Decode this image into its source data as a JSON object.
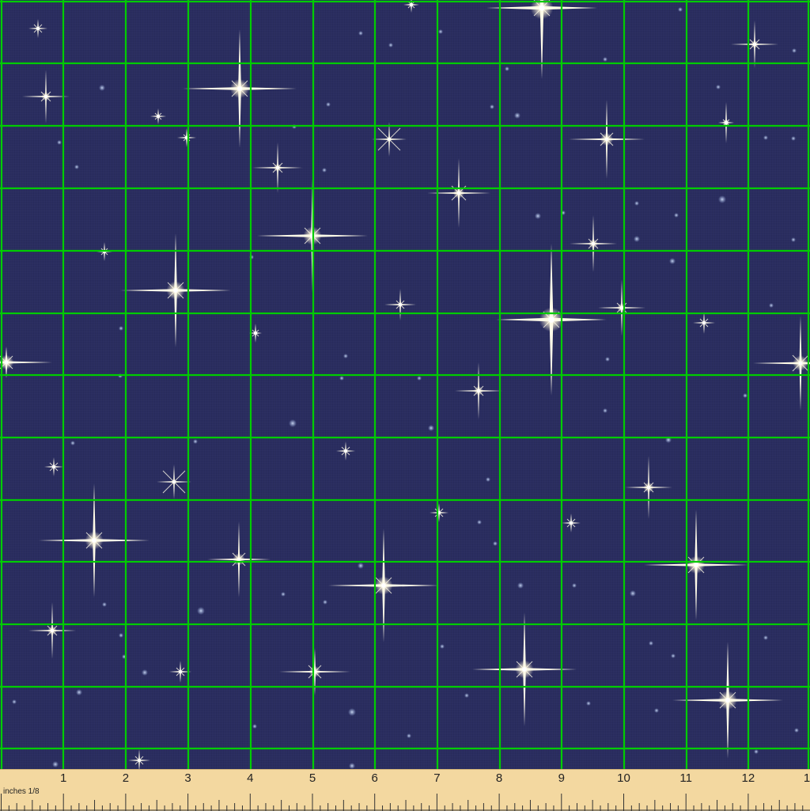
{
  "ruler": {
    "unit_label": "inches 1/8",
    "numbers": [
      "1",
      "2",
      "3",
      "4",
      "5",
      "6",
      "7",
      "8",
      "9",
      "10",
      "11",
      "12",
      "1"
    ]
  },
  "colors": {
    "background": "#2a2d60",
    "grid": "#00cc00",
    "star": "#fffbe8",
    "ruler": "#f3d8a0"
  }
}
